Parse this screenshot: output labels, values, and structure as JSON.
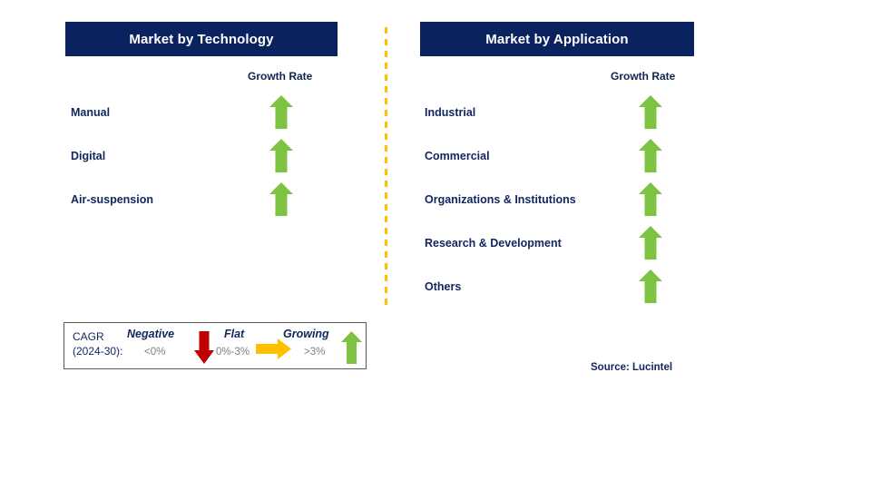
{
  "colors": {
    "header_bg": "#0A2260",
    "header_text": "#FFFFFF",
    "label_text": "#11265E",
    "arrow_growing": "#7DC242",
    "arrow_flat": "#FFC000",
    "arrow_negative": "#C00000",
    "divider": "#FFC000",
    "legend_border": "#595959",
    "legend_range_text": "#7F7F7F"
  },
  "panels": [
    {
      "id": "technology",
      "title": "Market by Technology",
      "growth_rate_label": "Growth Rate",
      "segments": [
        {
          "label": "Manual",
          "growth": "growing",
          "icon": "arrow-up-icon"
        },
        {
          "label": "Digital",
          "growth": "growing",
          "icon": "arrow-up-icon"
        },
        {
          "label": "Air-suspension",
          "growth": "growing",
          "icon": "arrow-up-icon"
        }
      ]
    },
    {
      "id": "application",
      "title": "Market by Application",
      "growth_rate_label": "Growth Rate",
      "segments": [
        {
          "label": "Industrial",
          "growth": "growing",
          "icon": "arrow-up-icon"
        },
        {
          "label": "Commercial",
          "growth": "growing",
          "icon": "arrow-up-icon"
        },
        {
          "label": "Organizations & Institutions",
          "growth": "growing",
          "icon": "arrow-up-icon"
        },
        {
          "label": "Research & Development",
          "growth": "growing",
          "icon": "arrow-up-icon"
        },
        {
          "label": "Others",
          "growth": "growing",
          "icon": "arrow-up-icon"
        }
      ]
    }
  ],
  "legend": {
    "title_line1": "CAGR",
    "title_line2": "(2024-30):",
    "entries": [
      {
        "term": "Negative",
        "range": "<0%",
        "icon": "arrow-down-icon",
        "color": "#C00000"
      },
      {
        "term": "Flat",
        "range": "0%-3%",
        "icon": "arrow-right-icon",
        "color": "#FFC000"
      },
      {
        "term": "Growing",
        "range": ">3%",
        "icon": "arrow-up-icon",
        "color": "#7DC242"
      }
    ]
  },
  "source": "Source: Lucintel"
}
